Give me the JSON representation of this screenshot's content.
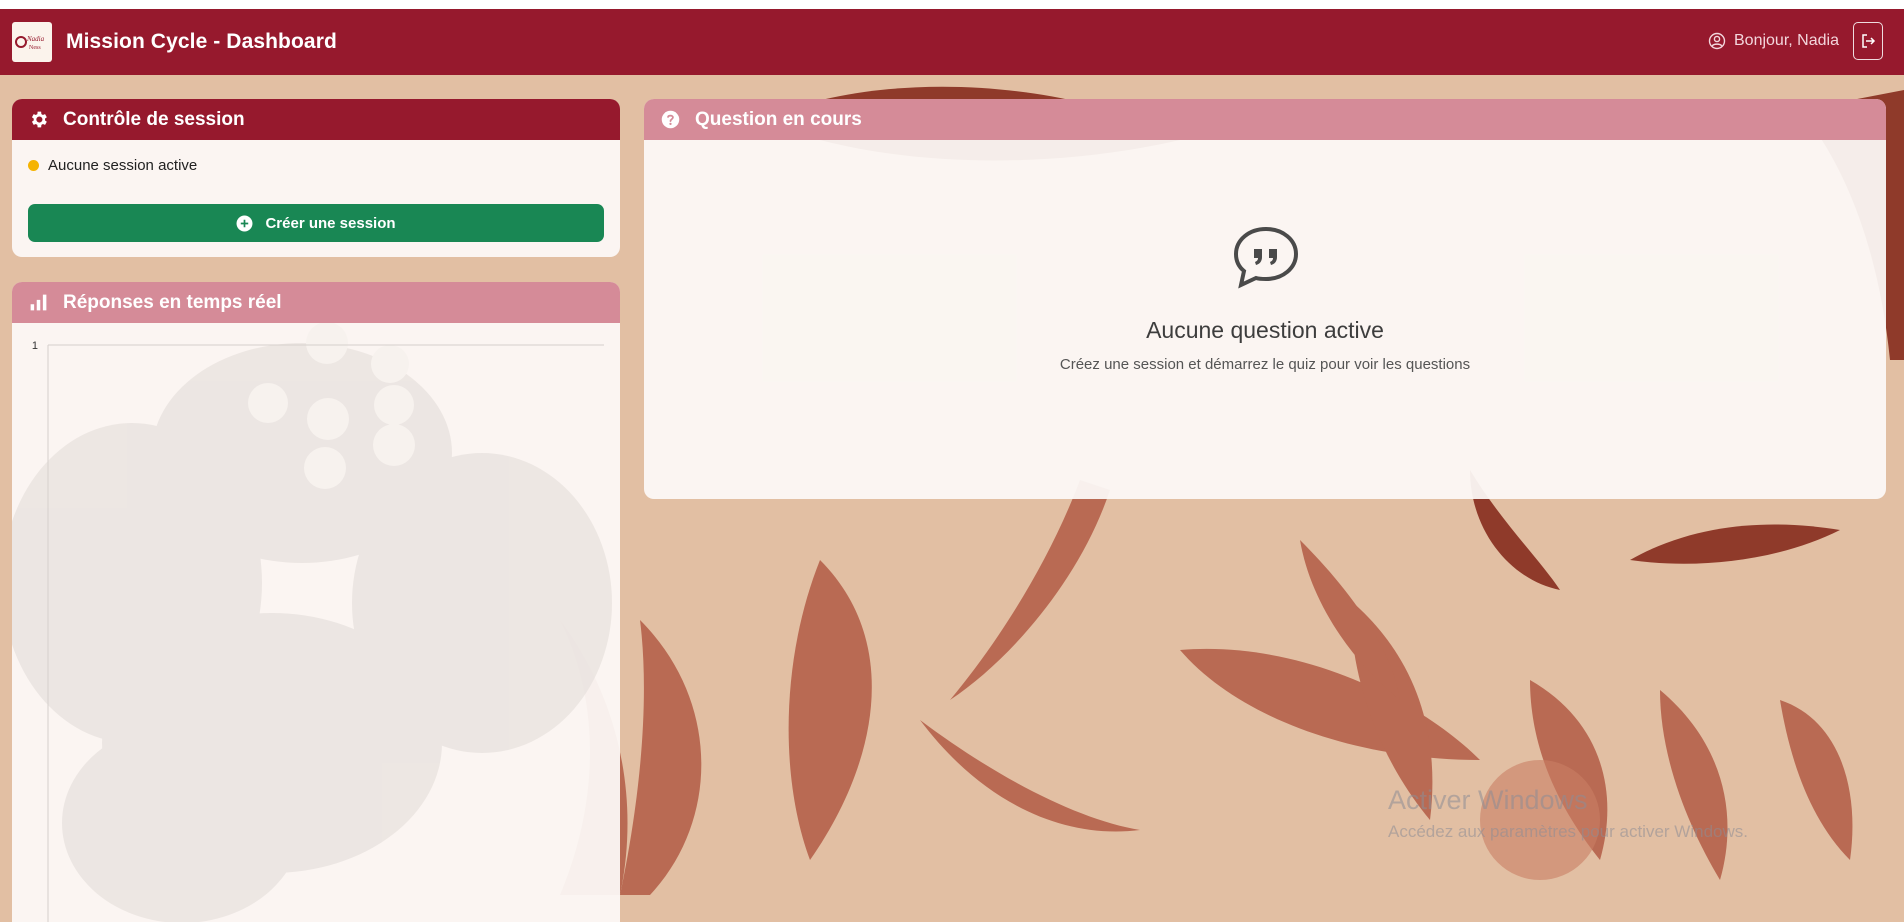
{
  "navbar": {
    "title": "Mission Cycle - Dashboard",
    "greeting": "Bonjour, Nadia",
    "logo_text": "Nadia Ness",
    "user_icon": "user-circle-icon",
    "logout_icon": "logout-icon"
  },
  "session": {
    "title": "Contrôle de session",
    "icon": "gear-icon",
    "status": "Aucune session active",
    "create_label": "Créer une session"
  },
  "responses": {
    "title": "Réponses en temps réel",
    "icon": "bar-chart-icon"
  },
  "question": {
    "title": "Question en cours",
    "icon": "question-circle-icon",
    "empty_title": "Aucune question active",
    "empty_subtitle": "Créez une session et démarrez le quiz pour voir les questions"
  },
  "chart_data": {
    "type": "bar",
    "categories": [],
    "series": [],
    "y_ticks": [
      "1"
    ],
    "ylim": [
      0,
      1
    ],
    "grid": true
  },
  "watermark": {
    "title": "Activer Windows",
    "subtitle": "Accédez aux paramètres pour activer Windows."
  },
  "colors": {
    "primary": "#96192d",
    "header_light": "#d58b98",
    "success": "#198754",
    "status_dot": "#f5b301",
    "background": "#e2bfa3"
  }
}
